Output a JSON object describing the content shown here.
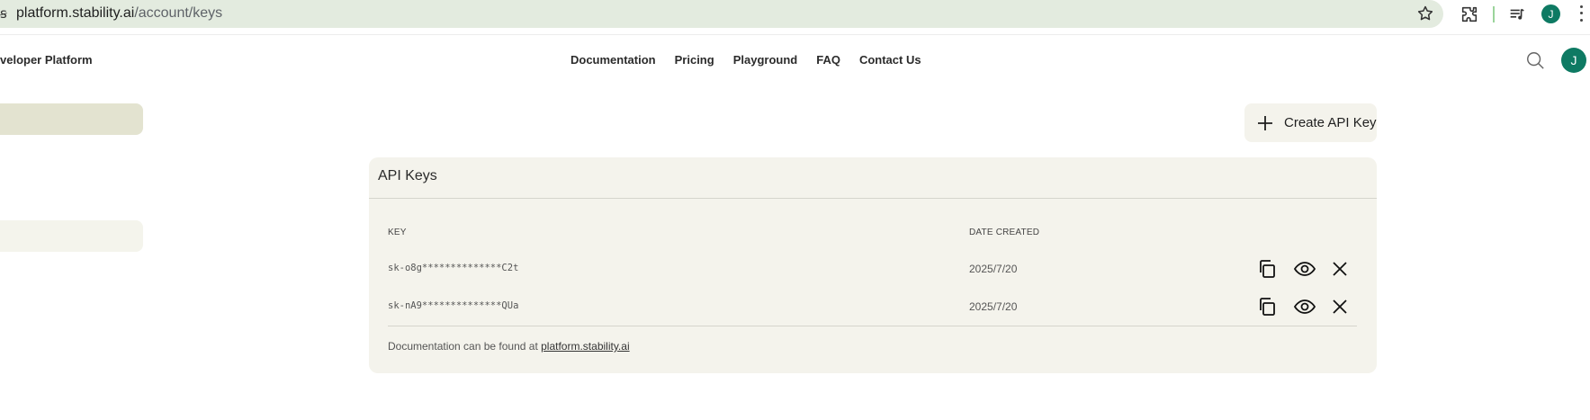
{
  "browser": {
    "url_host": "platform.stability.ai",
    "url_path": "/account/keys",
    "profile_initial": "J"
  },
  "header": {
    "brand": "veloper Platform",
    "nav": [
      "Documentation",
      "Pricing",
      "Playground",
      "FAQ",
      "Contact Us"
    ],
    "avatar_initial": "J"
  },
  "actions": {
    "create_label": "Create API Key"
  },
  "panel": {
    "title": "API Keys",
    "columns": {
      "key": "KEY",
      "date": "DATE CREATED"
    },
    "rows": [
      {
        "key": "sk-o8g**************C2t",
        "date": "2025/7/20"
      },
      {
        "key": "sk-nA9**************QUa",
        "date": "2025/7/20"
      }
    ],
    "footer_prefix": "Documentation can be found at ",
    "footer_link": "platform.stability.ai"
  },
  "colors": {
    "panel_bg": "#f4f3ec",
    "accent_avatar": "#0e7a63",
    "address_bar": "#e3ebdf"
  }
}
